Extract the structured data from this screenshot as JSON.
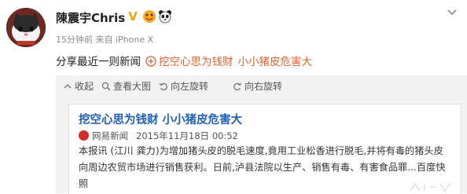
{
  "author": {
    "name": "陳震宇Chris",
    "verified_badge": "V",
    "badges": [
      "vip-face-icon",
      "panda-icon"
    ]
  },
  "meta": {
    "time": "15分钟前",
    "source": "来自 iPhone X"
  },
  "status": {
    "text": "分享最近一则新闻",
    "link_text": "挖空心思为钱财",
    "link_text_2": "小小猪皮危害大"
  },
  "image_toolbar": {
    "items": [
      {
        "icon": "collapse-icon",
        "label": "收起"
      },
      {
        "icon": "zoom-in-icon",
        "label": "查看大图"
      },
      {
        "icon": "rotate-left-icon",
        "label": "向左旋转"
      },
      {
        "icon": "rotate-right-icon",
        "label": "向右旋转"
      }
    ]
  },
  "news": {
    "title": "挖空心思为钱财 小小猪皮危害大",
    "source": "网易新闻",
    "date": "2015年11月18日 00:52",
    "body": "本报讯 (江川 龚力)为增加猪头皮的脱毛速度,竟用工业松香进行脱毛,并将有毒的猪头皮向周边农贸市场进行销售获利。日前,泸县法院以生产、销售有毒、有害食品罪...百度快照"
  },
  "colors": {
    "link": "#e0642d",
    "news_title": "#1f5fb8",
    "badge_gold": "#f2a400",
    "toolbar_bg": "#f2f2f2"
  }
}
